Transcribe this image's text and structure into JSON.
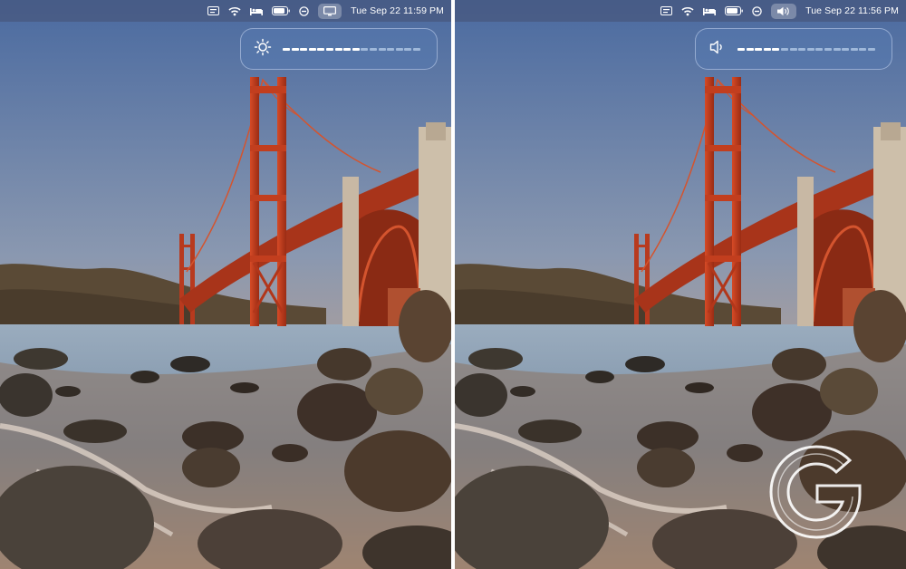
{
  "panels": [
    {
      "id": "left",
      "menubar": {
        "clock": "Tue Sep 22  11:59 PM",
        "active_item": "display-icon",
        "icons": [
          "keyboard-icon",
          "wifi-icon",
          "bed-icon",
          "battery-icon",
          "do-not-disturb-icon",
          "display-icon"
        ]
      },
      "hud": {
        "icon": "brightness-sun-icon",
        "level": 0.56,
        "segments": 16
      }
    },
    {
      "id": "right",
      "menubar": {
        "clock": "Tue Sep 22  11:56 PM",
        "active_item": "speaker-icon",
        "icons": [
          "keyboard-icon",
          "wifi-icon",
          "bed-icon",
          "battery-icon",
          "do-not-disturb-icon",
          "speaker-icon"
        ]
      },
      "hud": {
        "icon": "speaker-volume-icon",
        "level": 0.31,
        "segments": 16
      }
    }
  ],
  "colors": {
    "sky_top": "#4a6aa0",
    "sky_bottom": "#d6a880",
    "bridge": "#c2381c",
    "water": "#8aa0b4",
    "rock": "#3a3028",
    "hud_fill": "#ffffff",
    "hud_empty": "#9fb8da"
  }
}
